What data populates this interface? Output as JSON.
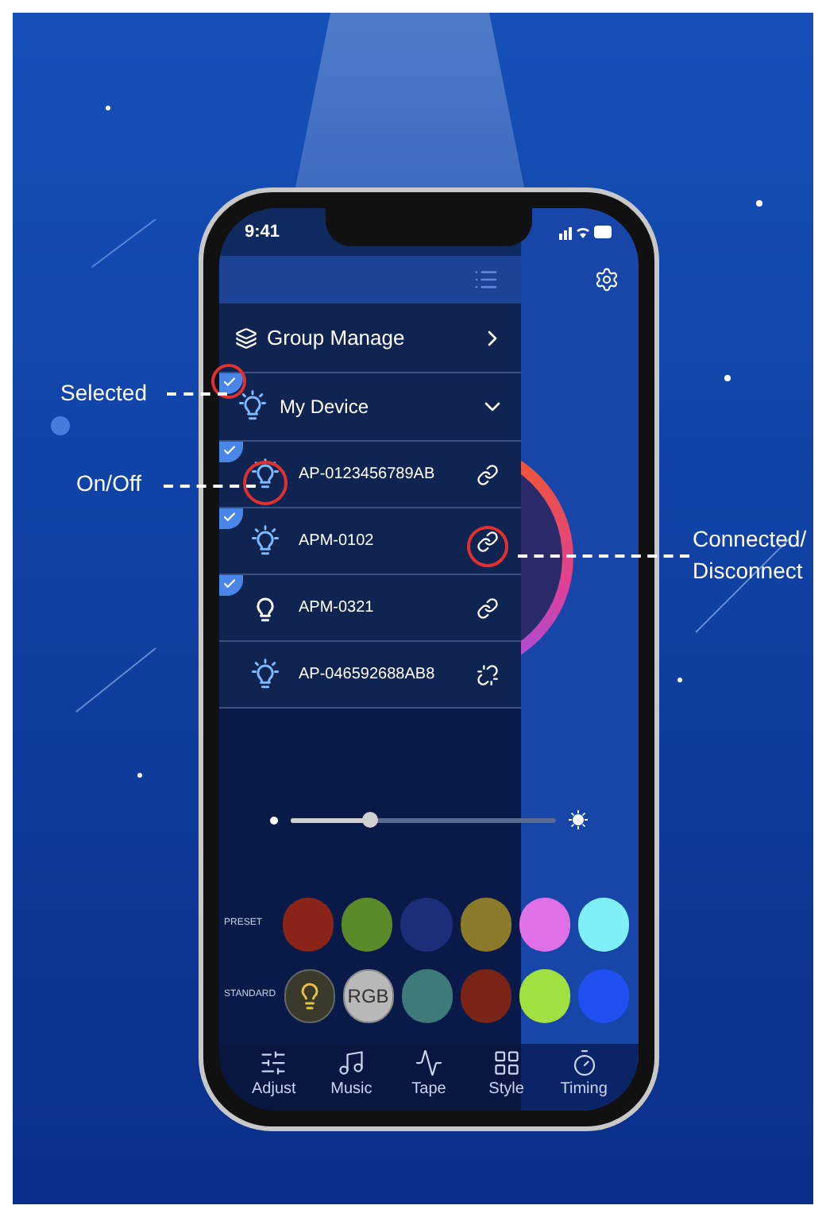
{
  "status_bar": {
    "time": "9:41"
  },
  "menu": {
    "group_manage": {
      "label": "Group Manage"
    },
    "my_device": {
      "label": "My Device",
      "selected": true,
      "expanded": true
    },
    "devices": [
      {
        "name": "AP-0123456789AB",
        "selected": true,
        "on": true,
        "connected": true
      },
      {
        "name": "APM-0102",
        "selected": true,
        "on": true,
        "connected": true
      },
      {
        "name": "APM-0321",
        "selected": true,
        "on": false,
        "connected": true
      },
      {
        "name": "AP-046592688AB8",
        "selected": false,
        "on": true,
        "connected": false
      }
    ]
  },
  "brightness": {
    "level": 0.3
  },
  "preset": {
    "label": "PRESET",
    "swatches": [
      {
        "color": "#8b2418"
      },
      {
        "color": "#5a8a2a"
      },
      {
        "color": "#1c2e7a"
      },
      {
        "color": "#8a7a2a"
      },
      {
        "color": "#e070e8"
      },
      {
        "color": "#80f0f8"
      }
    ]
  },
  "standard": {
    "label": "STANDARD",
    "swatches": [
      {
        "kind": "bulb"
      },
      {
        "kind": "text",
        "label": "RGB"
      },
      {
        "kind": "color",
        "color": "#3f7a7a"
      },
      {
        "kind": "color",
        "color": "#7a2418"
      },
      {
        "kind": "color",
        "color": "#a0e040"
      },
      {
        "kind": "color",
        "color": "#2050f0"
      }
    ]
  },
  "tabs": [
    {
      "label": "Adjust",
      "kind": "sliders"
    },
    {
      "label": "Music",
      "kind": "music"
    },
    {
      "label": "Tape",
      "kind": "wave"
    },
    {
      "label": "Style",
      "kind": "grid"
    },
    {
      "label": "Timing",
      "kind": "timer"
    }
  ],
  "annotations": [
    {
      "lines": [
        "Selected"
      ]
    },
    {
      "lines": [
        "On/Off"
      ]
    },
    {
      "lines": [
        "Connected/",
        "Disconnect"
      ]
    }
  ]
}
